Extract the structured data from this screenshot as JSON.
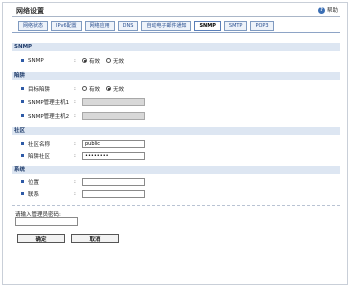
{
  "page": {
    "title": "网络设置",
    "help_label": "帮助",
    "help_icon": "question-icon"
  },
  "tabs": [
    {
      "label": "网络状态",
      "active": false
    },
    {
      "label": "IPv6配置",
      "active": false
    },
    {
      "label": "网络应用",
      "active": false
    },
    {
      "label": "DNS",
      "active": false
    },
    {
      "label": "自动电子邮件通知",
      "active": false
    },
    {
      "label": "SNMP",
      "active": true
    },
    {
      "label": "SMTP",
      "active": false
    },
    {
      "label": "POP3",
      "active": false
    }
  ],
  "snmp": {
    "header": "SNMP",
    "label": "SNMP",
    "enabled_label": "有效",
    "disabled_label": "无效",
    "enabled": true
  },
  "trap": {
    "header": "陷阱",
    "target_label": "目标陷阱",
    "enabled_label": "有效",
    "disabled_label": "无效",
    "enabled": false,
    "host1_label": "SNMP管理主机1",
    "host1_value": "",
    "host2_label": "SNMP管理主机2",
    "host2_value": ""
  },
  "community": {
    "header": "社区",
    "name_label": "社区名称",
    "name_value": "public",
    "trap_label": "陷阱社区",
    "trap_value": "••••••••"
  },
  "system": {
    "header": "系统",
    "location_label": "位置",
    "location_value": "",
    "contact_label": "联系",
    "contact_value": ""
  },
  "password": {
    "label": "请输入管理员密码:",
    "value": ""
  },
  "buttons": {
    "ok": "确定",
    "cancel": "取消"
  }
}
